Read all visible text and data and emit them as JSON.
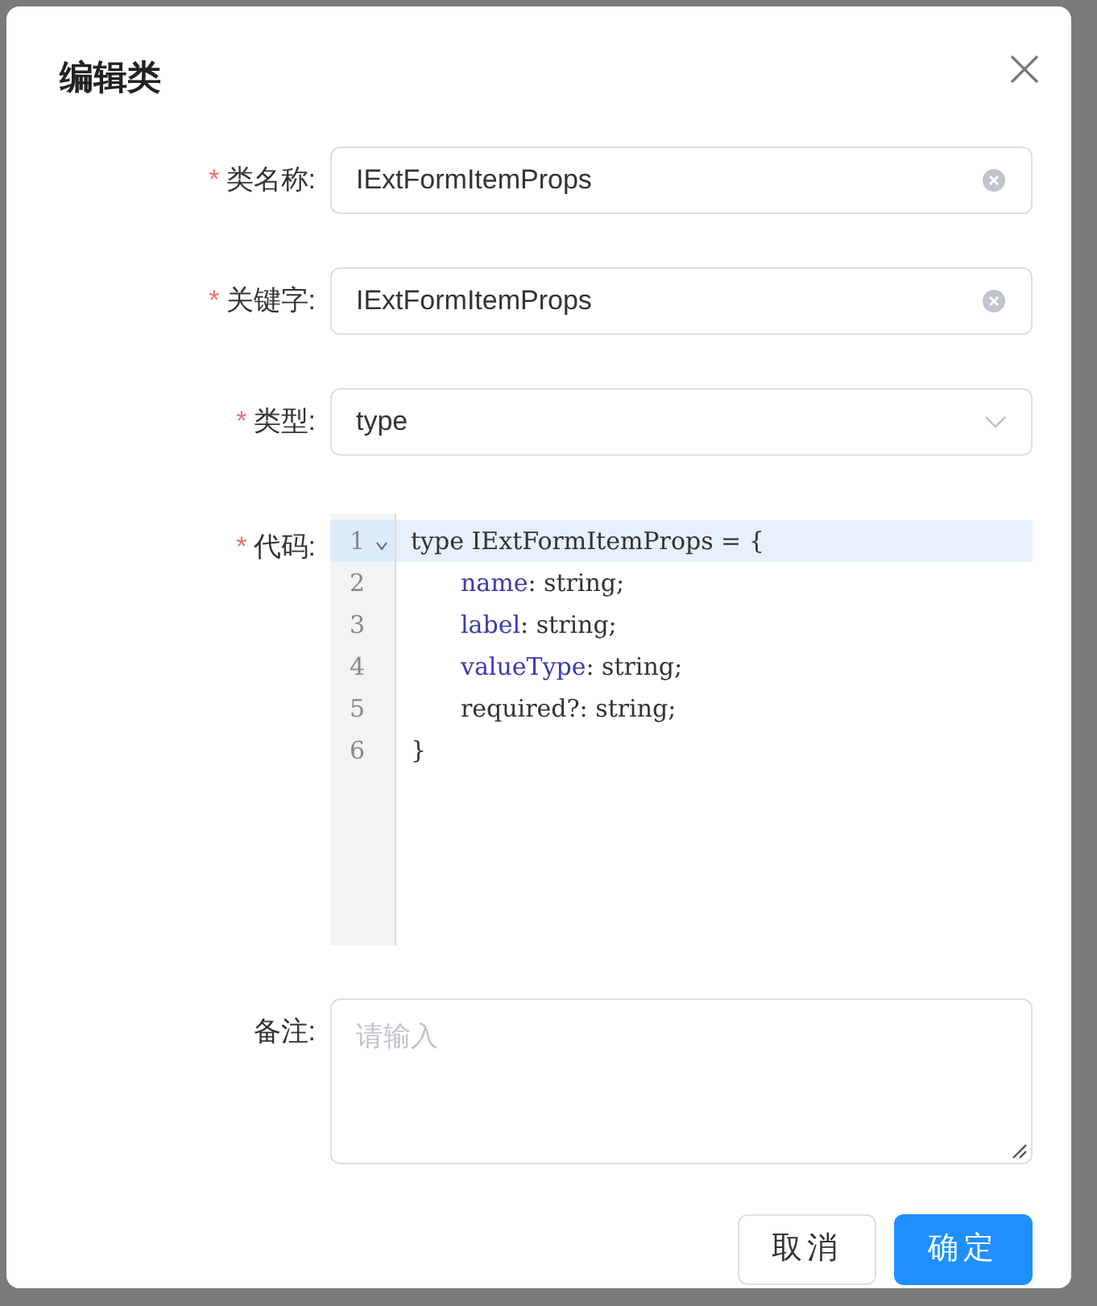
{
  "dialog": {
    "title": "编辑类"
  },
  "fields": [
    {
      "kind": "text",
      "label": "类名称:",
      "required_mark": "*",
      "value": "IExtFormItemProps",
      "clearable": true
    },
    {
      "kind": "text",
      "label": "关键字:",
      "required_mark": "*",
      "value": "IExtFormItemProps",
      "clearable": true
    },
    {
      "kind": "select",
      "label": "类型:",
      "required_mark": "*",
      "value": "type"
    },
    {
      "kind": "code",
      "label": "代码:",
      "required_mark": "*",
      "lines": [
        {
          "number": "1",
          "active": true,
          "foldable": true,
          "indented": false,
          "tokens": [
            {
              "text": "type IExtFormItemProps = {",
              "kind": "plain"
            }
          ]
        },
        {
          "number": "2",
          "active": false,
          "foldable": false,
          "indented": true,
          "tokens": [
            {
              "text": "name",
              "kind": "property"
            },
            {
              "text": ": string;",
              "kind": "plain"
            }
          ]
        },
        {
          "number": "3",
          "active": false,
          "foldable": false,
          "indented": true,
          "tokens": [
            {
              "text": "label",
              "kind": "property"
            },
            {
              "text": ": string;",
              "kind": "plain"
            }
          ]
        },
        {
          "number": "4",
          "active": false,
          "foldable": false,
          "indented": true,
          "tokens": [
            {
              "text": "valueType",
              "kind": "property"
            },
            {
              "text": ": string;",
              "kind": "plain"
            }
          ]
        },
        {
          "number": "5",
          "active": false,
          "foldable": false,
          "indented": true,
          "tokens": [
            {
              "text": "required?: string;",
              "kind": "plain"
            }
          ]
        },
        {
          "number": "6",
          "active": false,
          "foldable": false,
          "indented": false,
          "tokens": [
            {
              "text": "}",
              "kind": "plain"
            }
          ]
        }
      ]
    },
    {
      "kind": "textarea",
      "label": "备注:",
      "placeholder": "请输入"
    }
  ],
  "buttons": [
    {
      "label": "取消",
      "primary": false
    },
    {
      "label": "确定",
      "primary": true
    }
  ]
}
